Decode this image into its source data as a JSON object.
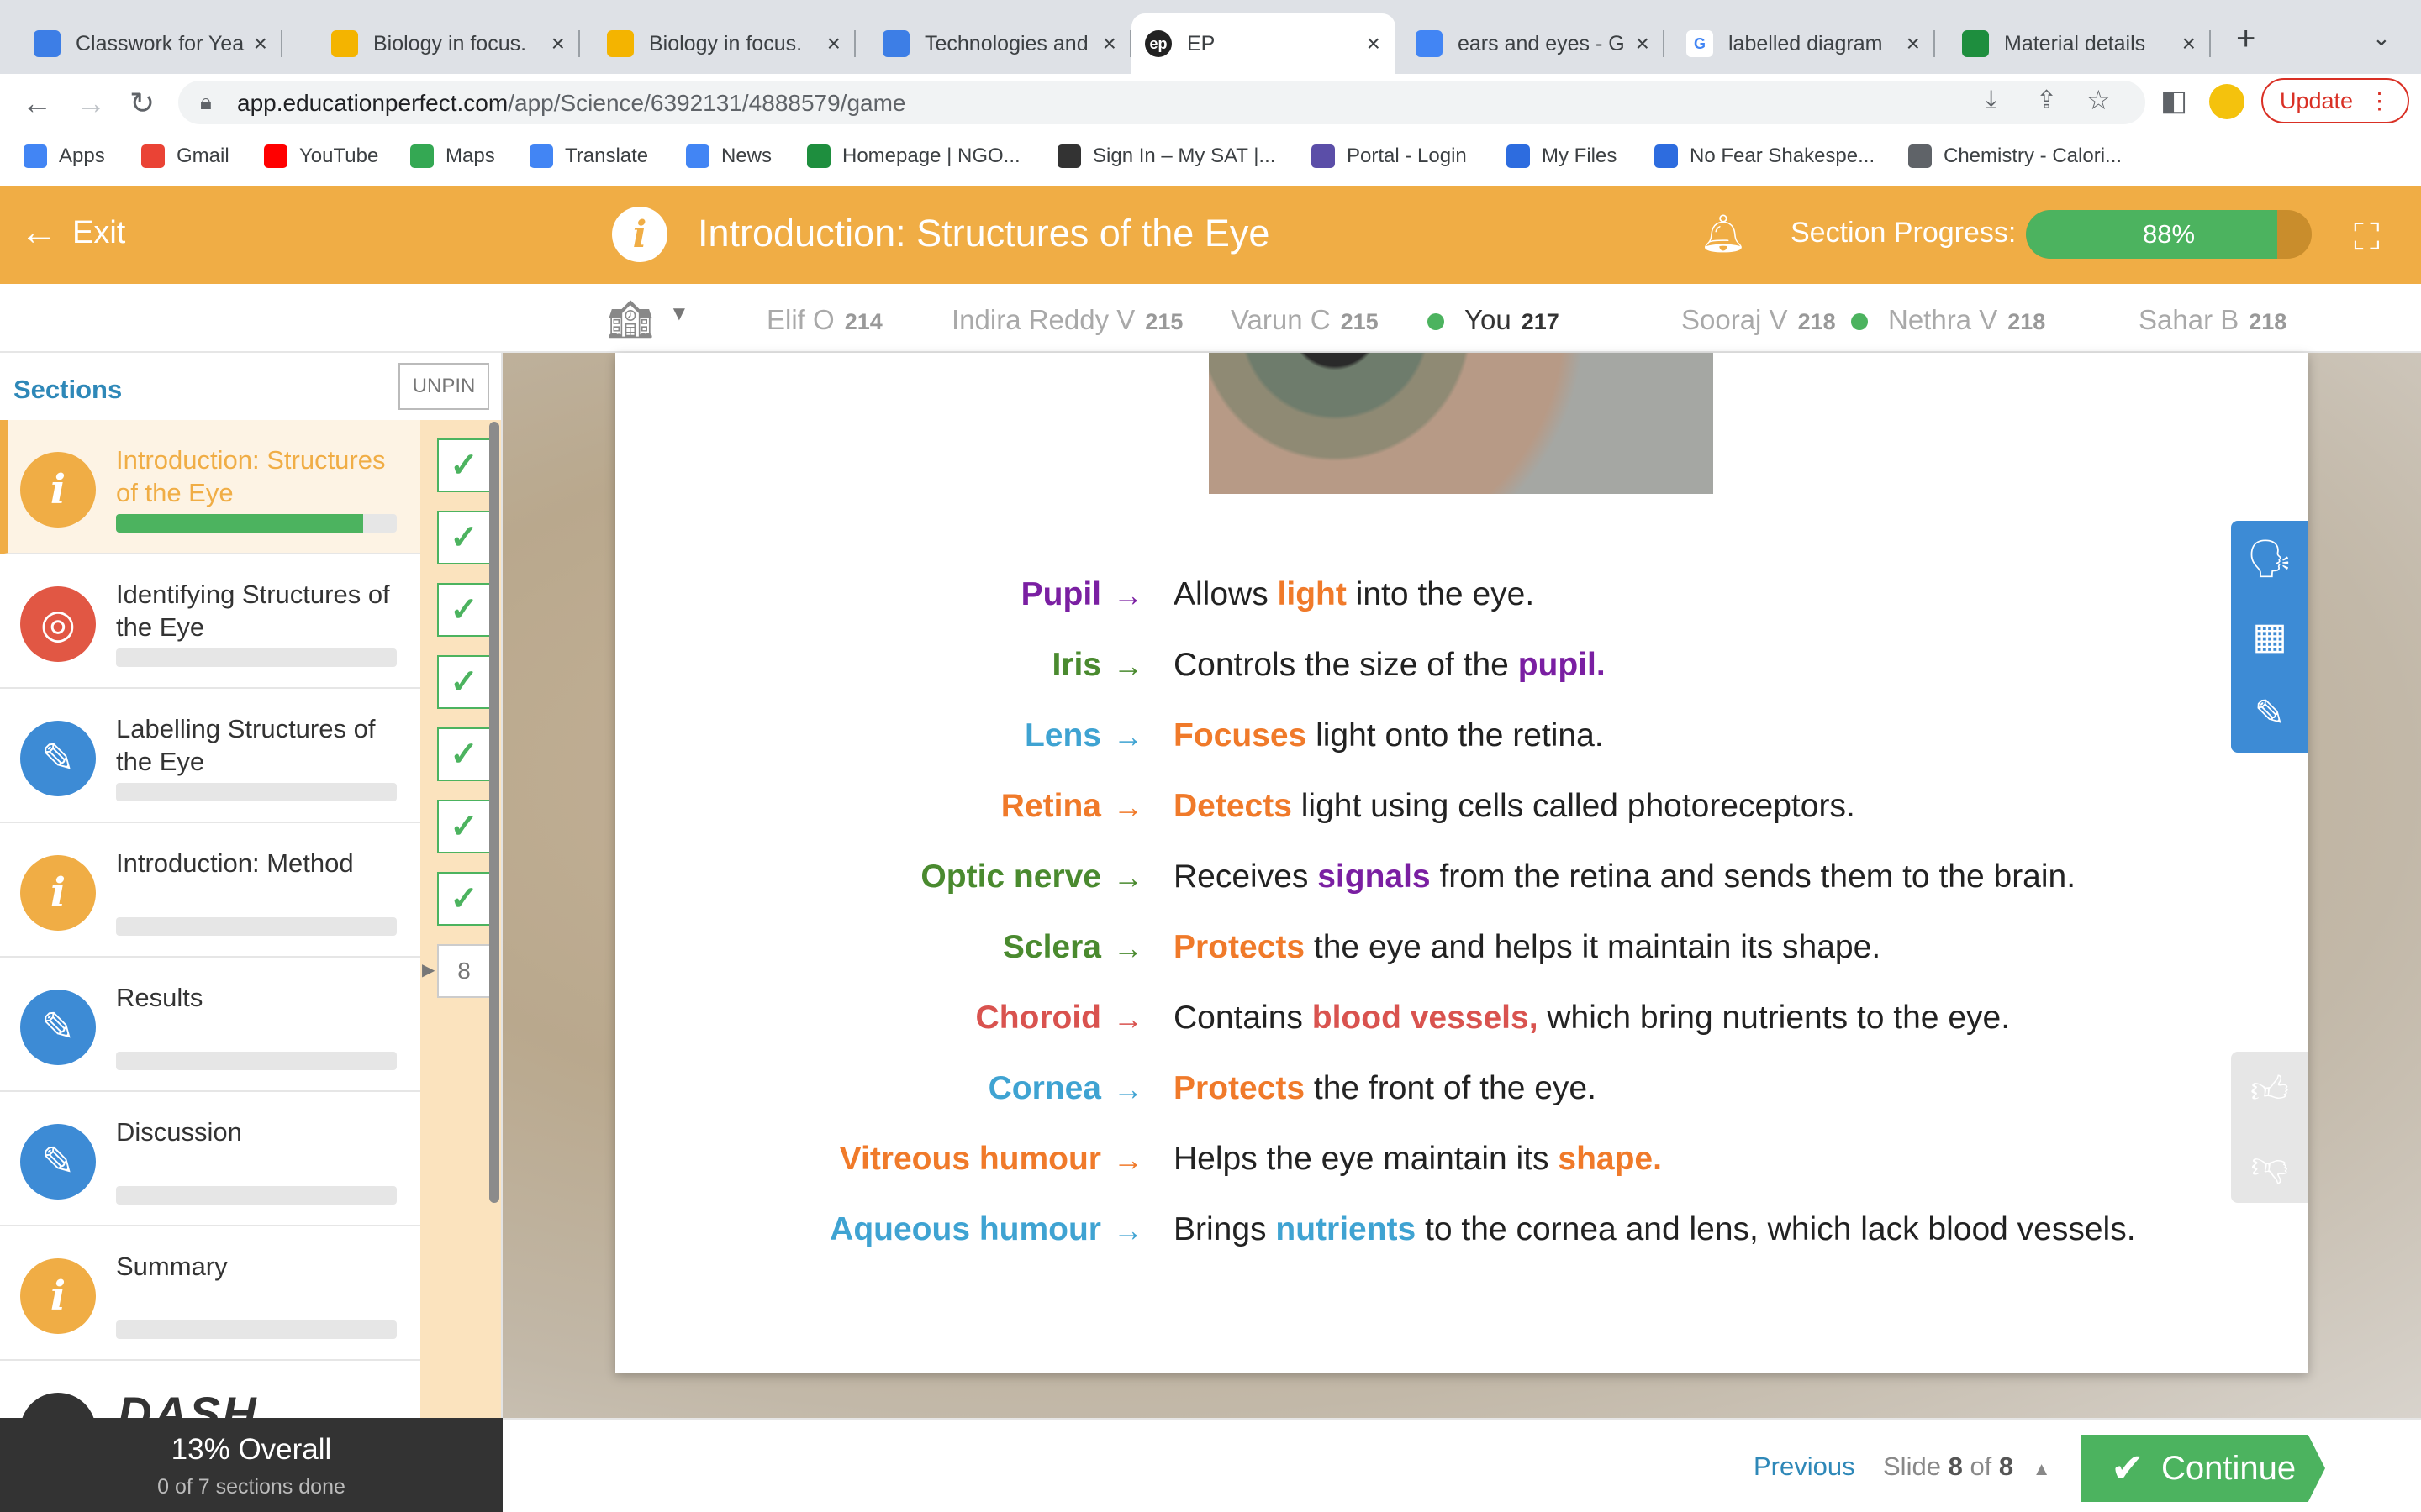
{
  "browser": {
    "tabs": [
      {
        "title": "Classwork for Yea",
        "favicon": "classroom-icon",
        "color": "#3d7ee6"
      },
      {
        "title": "Biology in focus.",
        "favicon": "drive-icon",
        "color": "#f4b400"
      },
      {
        "title": "Biology in focus.",
        "favicon": "drive-icon",
        "color": "#f4b400"
      },
      {
        "title": "Technologies and",
        "favicon": "classroom-icon",
        "color": "#3d7ee6"
      },
      {
        "title": "EP",
        "favicon": "ep-icon",
        "color": "#222222"
      },
      {
        "title": "ears and eyes - G",
        "favicon": "docs-icon",
        "color": "#4285f4"
      },
      {
        "title": "labelled diagram",
        "favicon": "google-icon",
        "color": "#ffffff"
      },
      {
        "title": "Material details",
        "favicon": "classroom-icon",
        "color": "#1e8e3e"
      }
    ],
    "new_tab": "+",
    "url_host": "app.educationperfect.com",
    "url_path": "/app/Science/6392131/4888579/game",
    "update_label": "Update",
    "bookmarks": [
      {
        "label": "Apps",
        "icon": "apps-grid-icon",
        "color": "#4285f4"
      },
      {
        "label": "Gmail",
        "icon": "gmail-icon",
        "color": "#ea4335"
      },
      {
        "label": "YouTube",
        "icon": "youtube-icon",
        "color": "#ff0000"
      },
      {
        "label": "Maps",
        "icon": "maps-icon",
        "color": "#34a853"
      },
      {
        "label": "Translate",
        "icon": "translate-icon",
        "color": "#4285f4"
      },
      {
        "label": "News",
        "icon": "news-icon",
        "color": "#4285f4"
      },
      {
        "label": "Homepage | NGO...",
        "icon": "ngo-icon",
        "color": "#1e8e3e"
      },
      {
        "label": "Sign In – My SAT |...",
        "icon": "sat-icon",
        "color": "#333333"
      },
      {
        "label": "Portal - Login",
        "icon": "portal-icon",
        "color": "#5b4ea8"
      },
      {
        "label": "My Files",
        "icon": "files-icon",
        "color": "#2d6cdf"
      },
      {
        "label": "No Fear Shakespe...",
        "icon": "nofear-icon",
        "color": "#2d6cdf"
      },
      {
        "label": "Chemistry - Calori...",
        "icon": "folder-icon",
        "color": "#5f6368"
      }
    ]
  },
  "header": {
    "exit_label": "Exit",
    "lesson_title": "Introduction: Structures of the Eye",
    "progress_label": "Section Progress:",
    "progress_value": "88%",
    "progress_fraction": 0.88,
    "brand_color": "#f0ad45"
  },
  "leaderboard": [
    {
      "name": "Elif O",
      "score": "214",
      "online": false,
      "you": false
    },
    {
      "name": "Indira Reddy V",
      "score": "215",
      "online": false,
      "you": false
    },
    {
      "name": "Varun C",
      "score": "215",
      "online": false,
      "you": false
    },
    {
      "name": "You",
      "score": "217",
      "online": true,
      "you": true
    },
    {
      "name": "Sooraj V",
      "score": "218",
      "online": false,
      "you": false
    },
    {
      "name": "Nethra V",
      "score": "218",
      "online": true,
      "you": false
    },
    {
      "name": "Sahar B",
      "score": "218",
      "online": false,
      "you": false
    }
  ],
  "sidebar": {
    "title": "Sections",
    "unpin_label": "UNPIN",
    "sections": [
      {
        "label": "Introduction: Structures of the Eye",
        "icon": "info-icon",
        "progress": 0.88,
        "active": true
      },
      {
        "label": "Identifying Structures of the Eye",
        "icon": "target-icon",
        "progress": 0,
        "active": false
      },
      {
        "label": "Labelling Structures of the Eye",
        "icon": "pencil-icon",
        "progress": 0,
        "active": false
      },
      {
        "label": "Introduction: Method",
        "icon": "info-icon",
        "progress": 0,
        "active": false
      },
      {
        "label": "Results",
        "icon": "pencil-icon",
        "progress": 0,
        "active": false
      },
      {
        "label": "Discussion",
        "icon": "pencil-icon",
        "progress": 0,
        "active": false
      },
      {
        "label": "Summary",
        "icon": "info-icon",
        "progress": 0,
        "active": false
      }
    ],
    "dash_logo": "DASH",
    "completed_slides": 7,
    "current_slide_marker": "8"
  },
  "overall": {
    "percent_label": "13% Overall",
    "sections_done": "0 of 7 sections done"
  },
  "content": {
    "rows": [
      {
        "term": "Pupil",
        "term_color": "purple",
        "parts": [
          {
            "t": "Allows "
          },
          {
            "t": "light",
            "c": "orange"
          },
          {
            "t": " into the eye."
          }
        ]
      },
      {
        "term": "Iris",
        "term_color": "green",
        "parts": [
          {
            "t": "Controls the size of the "
          },
          {
            "t": "pupil.",
            "c": "purple"
          }
        ]
      },
      {
        "term": "Lens",
        "term_color": "blue",
        "parts": [
          {
            "t": "Focuses",
            "c": "orange"
          },
          {
            "t": " light onto the retina."
          }
        ]
      },
      {
        "term": "Retina",
        "term_color": "orange",
        "parts": [
          {
            "t": "Detects",
            "c": "orange"
          },
          {
            "t": " light using cells called photoreceptors."
          }
        ]
      },
      {
        "term": "Optic nerve",
        "term_color": "green",
        "parts": [
          {
            "t": "Receives "
          },
          {
            "t": "signals",
            "c": "purple"
          },
          {
            "t": " from the retina and sends them to the brain."
          }
        ]
      },
      {
        "term": "Sclera",
        "term_color": "green",
        "parts": [
          {
            "t": "Protects",
            "c": "orange"
          },
          {
            "t": " the eye and helps it maintain its shape."
          }
        ]
      },
      {
        "term": "Choroid",
        "term_color": "red",
        "parts": [
          {
            "t": "Contains "
          },
          {
            "t": "blood vessels,",
            "c": "red"
          },
          {
            "t": " which bring nutrients to the eye."
          }
        ]
      },
      {
        "term": "Cornea",
        "term_color": "blue",
        "parts": [
          {
            "t": "Protects",
            "c": "orange"
          },
          {
            "t": " the front of the eye."
          }
        ]
      },
      {
        "term": "Vitreous humour",
        "term_color": "orange",
        "parts": [
          {
            "t": "Helps the eye maintain its "
          },
          {
            "t": "shape.",
            "c": "orange"
          }
        ]
      },
      {
        "term": "Aqueous humour",
        "term_color": "blue",
        "parts": [
          {
            "t": "Brings "
          },
          {
            "t": "nutrients",
            "c": "blue"
          },
          {
            "t": " to the cornea and lens, which lack blood vessels."
          }
        ]
      }
    ],
    "arrow": "→"
  },
  "footer": {
    "previous_label": "Previous",
    "slide_prefix": "Slide",
    "slide_current": "8",
    "slide_of": "of",
    "slide_total": "8",
    "continue_label": "Continue"
  }
}
